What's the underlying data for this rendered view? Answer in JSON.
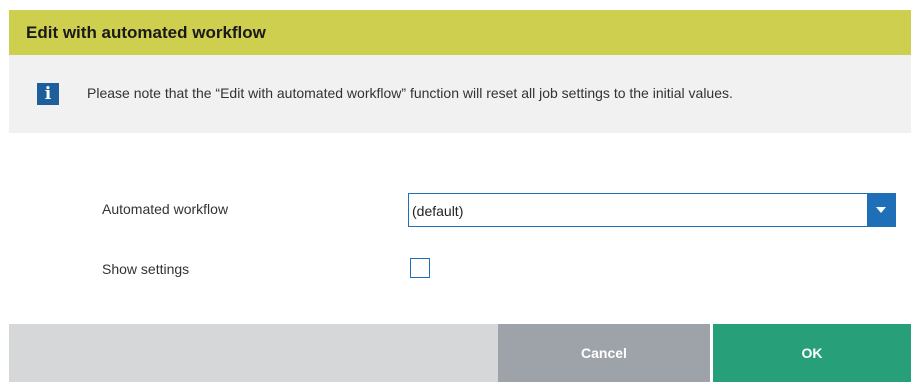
{
  "dialog": {
    "title": "Edit with automated workflow",
    "info": {
      "icon": "info-icon",
      "glyph": "i",
      "message": "Please note that the “Edit with automated workflow” function will reset all job settings to the initial values."
    },
    "fields": {
      "workflow_label": "Automated workflow",
      "workflow_value": "(default)",
      "show_settings_label": "Show settings",
      "show_settings_checked": false
    },
    "buttons": {
      "cancel": "Cancel",
      "ok": "OK"
    },
    "colors": {
      "title_bar": "#cfcf4f",
      "accent": "#1f6fb8",
      "ok": "#27a07a",
      "cancel": "#9ea3aa"
    }
  }
}
